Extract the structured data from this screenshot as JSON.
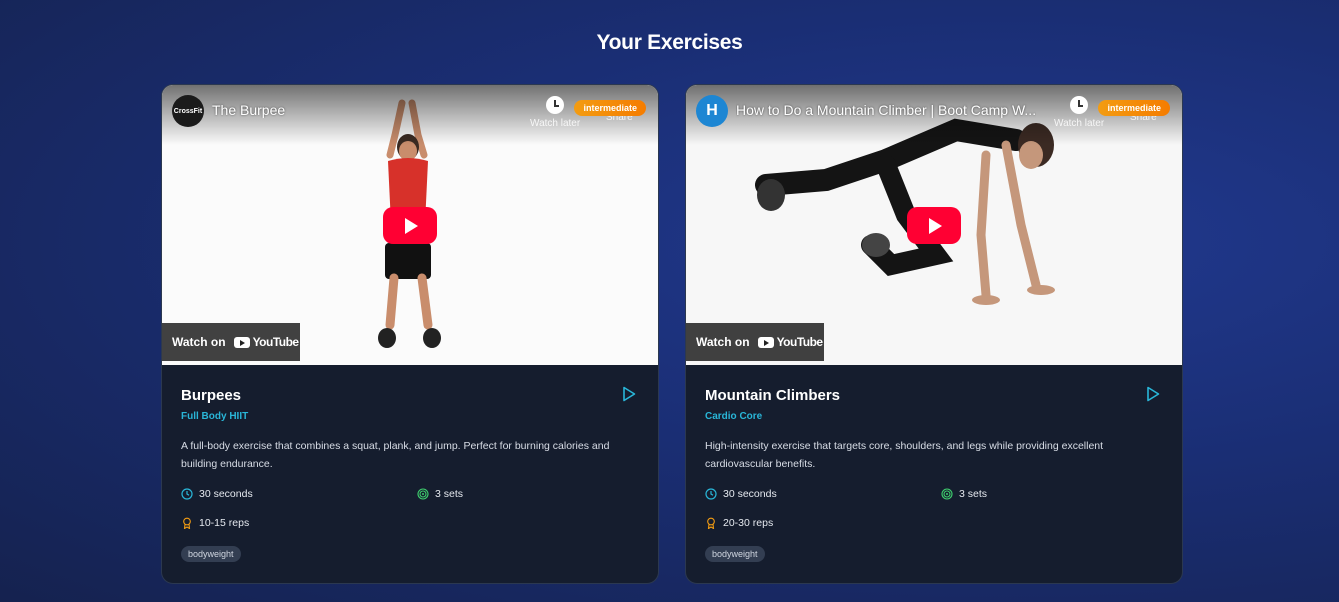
{
  "page": {
    "title": "Your Exercises"
  },
  "youtube": {
    "watch_later": "Watch later",
    "share": "Share",
    "watch_on": "Watch on",
    "youtube_label": "YouTube"
  },
  "exercises": [
    {
      "video_title": "The Burpee",
      "channel_logo_text": "CrossFit",
      "difficulty": "intermediate",
      "name": "Burpees",
      "category": "Full Body HIIT",
      "description": "A full-body exercise that combines a squat, plank, and jump. Perfect for burning calories and building endurance.",
      "duration": "30 seconds",
      "sets": "3 sets",
      "reps": "10-15 reps",
      "tag": "bodyweight"
    },
    {
      "video_title": "How to Do a Mountain Climber | Boot Camp W...",
      "channel_logo_text": "H",
      "difficulty": "intermediate",
      "name": "Mountain Climbers",
      "category": "Cardio Core",
      "description": "High-intensity exercise that targets core, shoulders, and legs while providing excellent cardiovascular benefits.",
      "duration": "30 seconds",
      "sets": "3 sets",
      "reps": "20-30 reps",
      "tag": "bodyweight"
    }
  ],
  "colors": {
    "accent_cyan": "#29b6d8",
    "badge_orange": "#f57c00",
    "youtube_red": "#ff0033",
    "card_bg": "#151d2e"
  }
}
